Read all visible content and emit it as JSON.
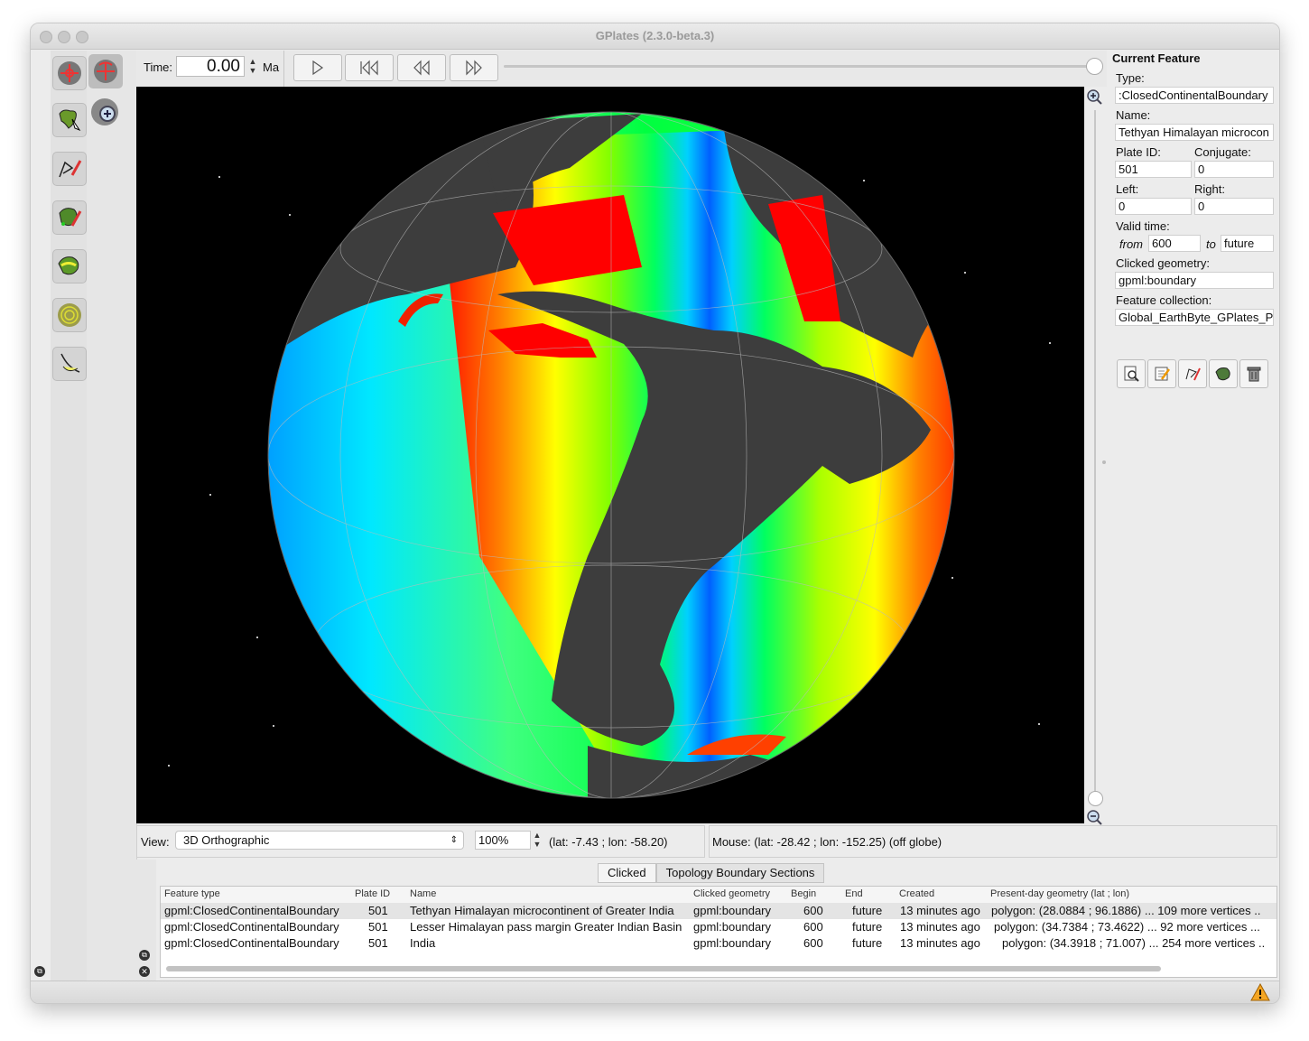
{
  "window": {
    "title": "GPlates (2.3.0-beta.3)"
  },
  "time": {
    "label": "Time:",
    "value": "0.00",
    "unit": "Ma"
  },
  "playback": {
    "buttons": [
      "play-icon",
      "rewind-to-start-icon",
      "step-back-icon",
      "step-forward-icon"
    ],
    "slider_position": 1.0
  },
  "tools": {
    "group_a": [
      "drag-globe-icon",
      "choose-feature-icon",
      "digitise-geometry-icon",
      "edit-topology-icon",
      "build-topology-icon",
      "measure-distance-icon",
      "pole-manipulation-icon"
    ],
    "group_b": [
      "rotate-globe-icon",
      "zoom-globe-icon"
    ]
  },
  "current_feature": {
    "header": "Current Feature",
    "type_label": "Type:",
    "type_value": ":ClosedContinentalBoundary",
    "name_label": "Name:",
    "name_value": "Tethyan Himalayan microcon",
    "plate_id_label": "Plate ID:",
    "plate_id_value": "501",
    "conjugate_label": "Conjugate:",
    "conjugate_value": "0",
    "left_label": "Left:",
    "left_value": "0",
    "right_label": "Right:",
    "right_value": "0",
    "valid_time_label": "Valid time:",
    "from_label": "from",
    "from_value": "600",
    "to_label": "to",
    "to_value": "future",
    "clicked_geometry_label": "Clicked geometry:",
    "clicked_geometry_value": "gpml:boundary",
    "feature_collection_label": "Feature collection:",
    "feature_collection_value": "Global_EarthByte_GPlates_P",
    "action_icons": [
      "query-feature-icon",
      "edit-feature-icon",
      "vertex-edit-icon",
      "plate-icon",
      "delete-icon"
    ]
  },
  "view": {
    "label": "View:",
    "projection": "3D Orthographic",
    "zoom": "100%",
    "center": "(lat: -7.43 ; lon: -58.20)"
  },
  "mouse": {
    "text": "Mouse: (lat: -28.42 ; lon: -152.25) (off globe)"
  },
  "tabs": [
    "Clicked",
    "Topology Boundary Sections"
  ],
  "table": {
    "columns": [
      "Feature type",
      "Plate ID",
      "Name",
      "Clicked geometry",
      "Begin",
      "End",
      "Created",
      "Present-day geometry (lat ; lon)"
    ],
    "rows": [
      [
        "gpml:ClosedContinentalBoundary",
        "501",
        "Tethyan Himalayan microcontinent of Greater India",
        "gpml:boundary",
        "600",
        "future",
        "13 minutes ago",
        "polygon: (28.0884 ; 96.1886) ... 109 more vertices .."
      ],
      [
        "gpml:ClosedContinentalBoundary",
        "501",
        "Lesser Himalayan pass margin Greater Indian Basin",
        "gpml:boundary",
        "600",
        "future",
        "13 minutes ago",
        "polygon: (34.7384 ; 73.4622) ... 92 more vertices ..."
      ],
      [
        "gpml:ClosedContinentalBoundary",
        "501",
        "India",
        "gpml:boundary",
        "600",
        "future",
        "13 minutes ago",
        "polygon: (34.3918 ; 71.007) ... 254 more vertices .."
      ]
    ]
  },
  "colors": {
    "ocean_young": "#ff0000",
    "ocean_mid": "#00ff60",
    "ocean_old": "#0040ff",
    "continent": "#3d3d3d",
    "space": "#000000"
  },
  "status": {
    "warning_icon": "warning-icon"
  }
}
